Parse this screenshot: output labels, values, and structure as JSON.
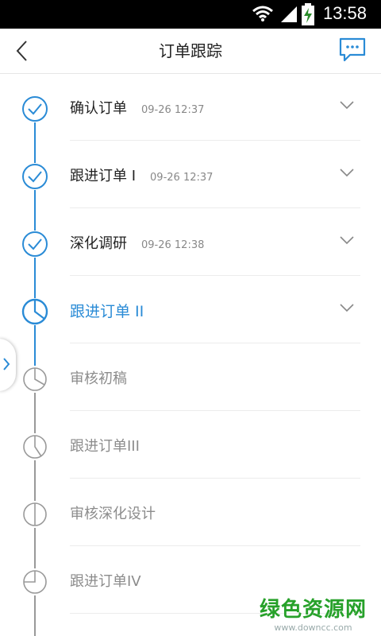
{
  "status": {
    "time": "13:58"
  },
  "header": {
    "title": "订单跟踪"
  },
  "steps": [
    {
      "label": "确认订单",
      "time": "09-26 12:37",
      "state": "done"
    },
    {
      "label": "跟进订单 I",
      "time": "09-26 12:37",
      "state": "done"
    },
    {
      "label": "深化调研",
      "time": "09-26 12:38",
      "state": "done"
    },
    {
      "label": "跟进订单 II",
      "time": "",
      "state": "current"
    },
    {
      "label": "审核初稿",
      "time": "",
      "state": "pending"
    },
    {
      "label": "跟进订单III",
      "time": "",
      "state": "pending"
    },
    {
      "label": "审核深化设计",
      "time": "",
      "state": "pending"
    },
    {
      "label": "跟进订单IV",
      "time": "",
      "state": "pending"
    }
  ],
  "watermark": {
    "line1": "绿色资源网",
    "line2": "www.downcc.com"
  },
  "colors": {
    "accent": "#2a8bd6",
    "pending": "#8c8c8c",
    "line_done": "#2a8bd6",
    "line_pending": "#999999"
  }
}
